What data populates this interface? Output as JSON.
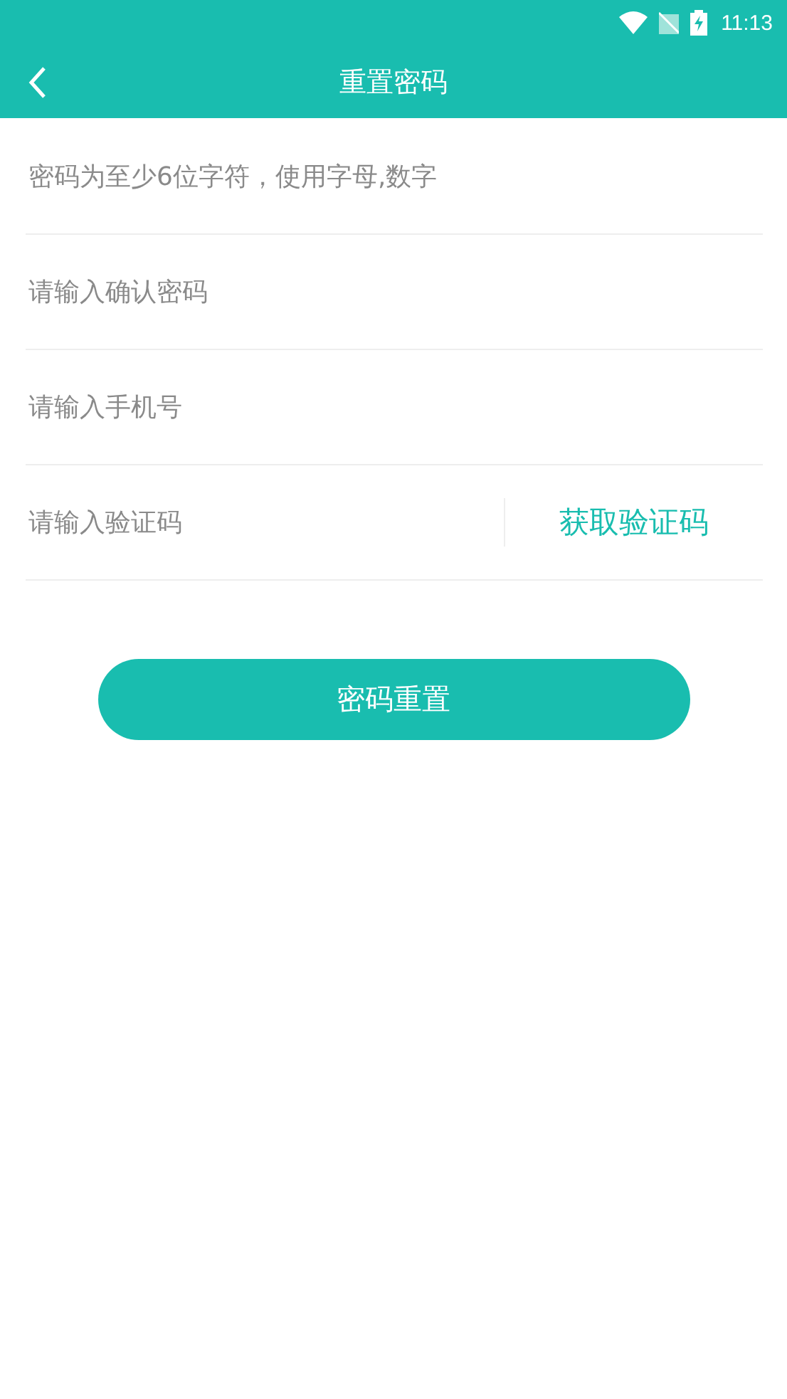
{
  "status_bar": {
    "time": "11:13"
  },
  "app_bar": {
    "title": "重置密码"
  },
  "fields": [
    {
      "kind": "plain",
      "placeholder": "密码为至少6位字符，使用字母,数字"
    },
    {
      "kind": "plain",
      "placeholder": "请输入确认密码"
    },
    {
      "kind": "plain",
      "placeholder": "请输入手机号"
    },
    {
      "kind": "code",
      "placeholder": "请输入验证码",
      "action": "获取验证码"
    }
  ],
  "submit_button": {
    "label": "密码重置"
  }
}
